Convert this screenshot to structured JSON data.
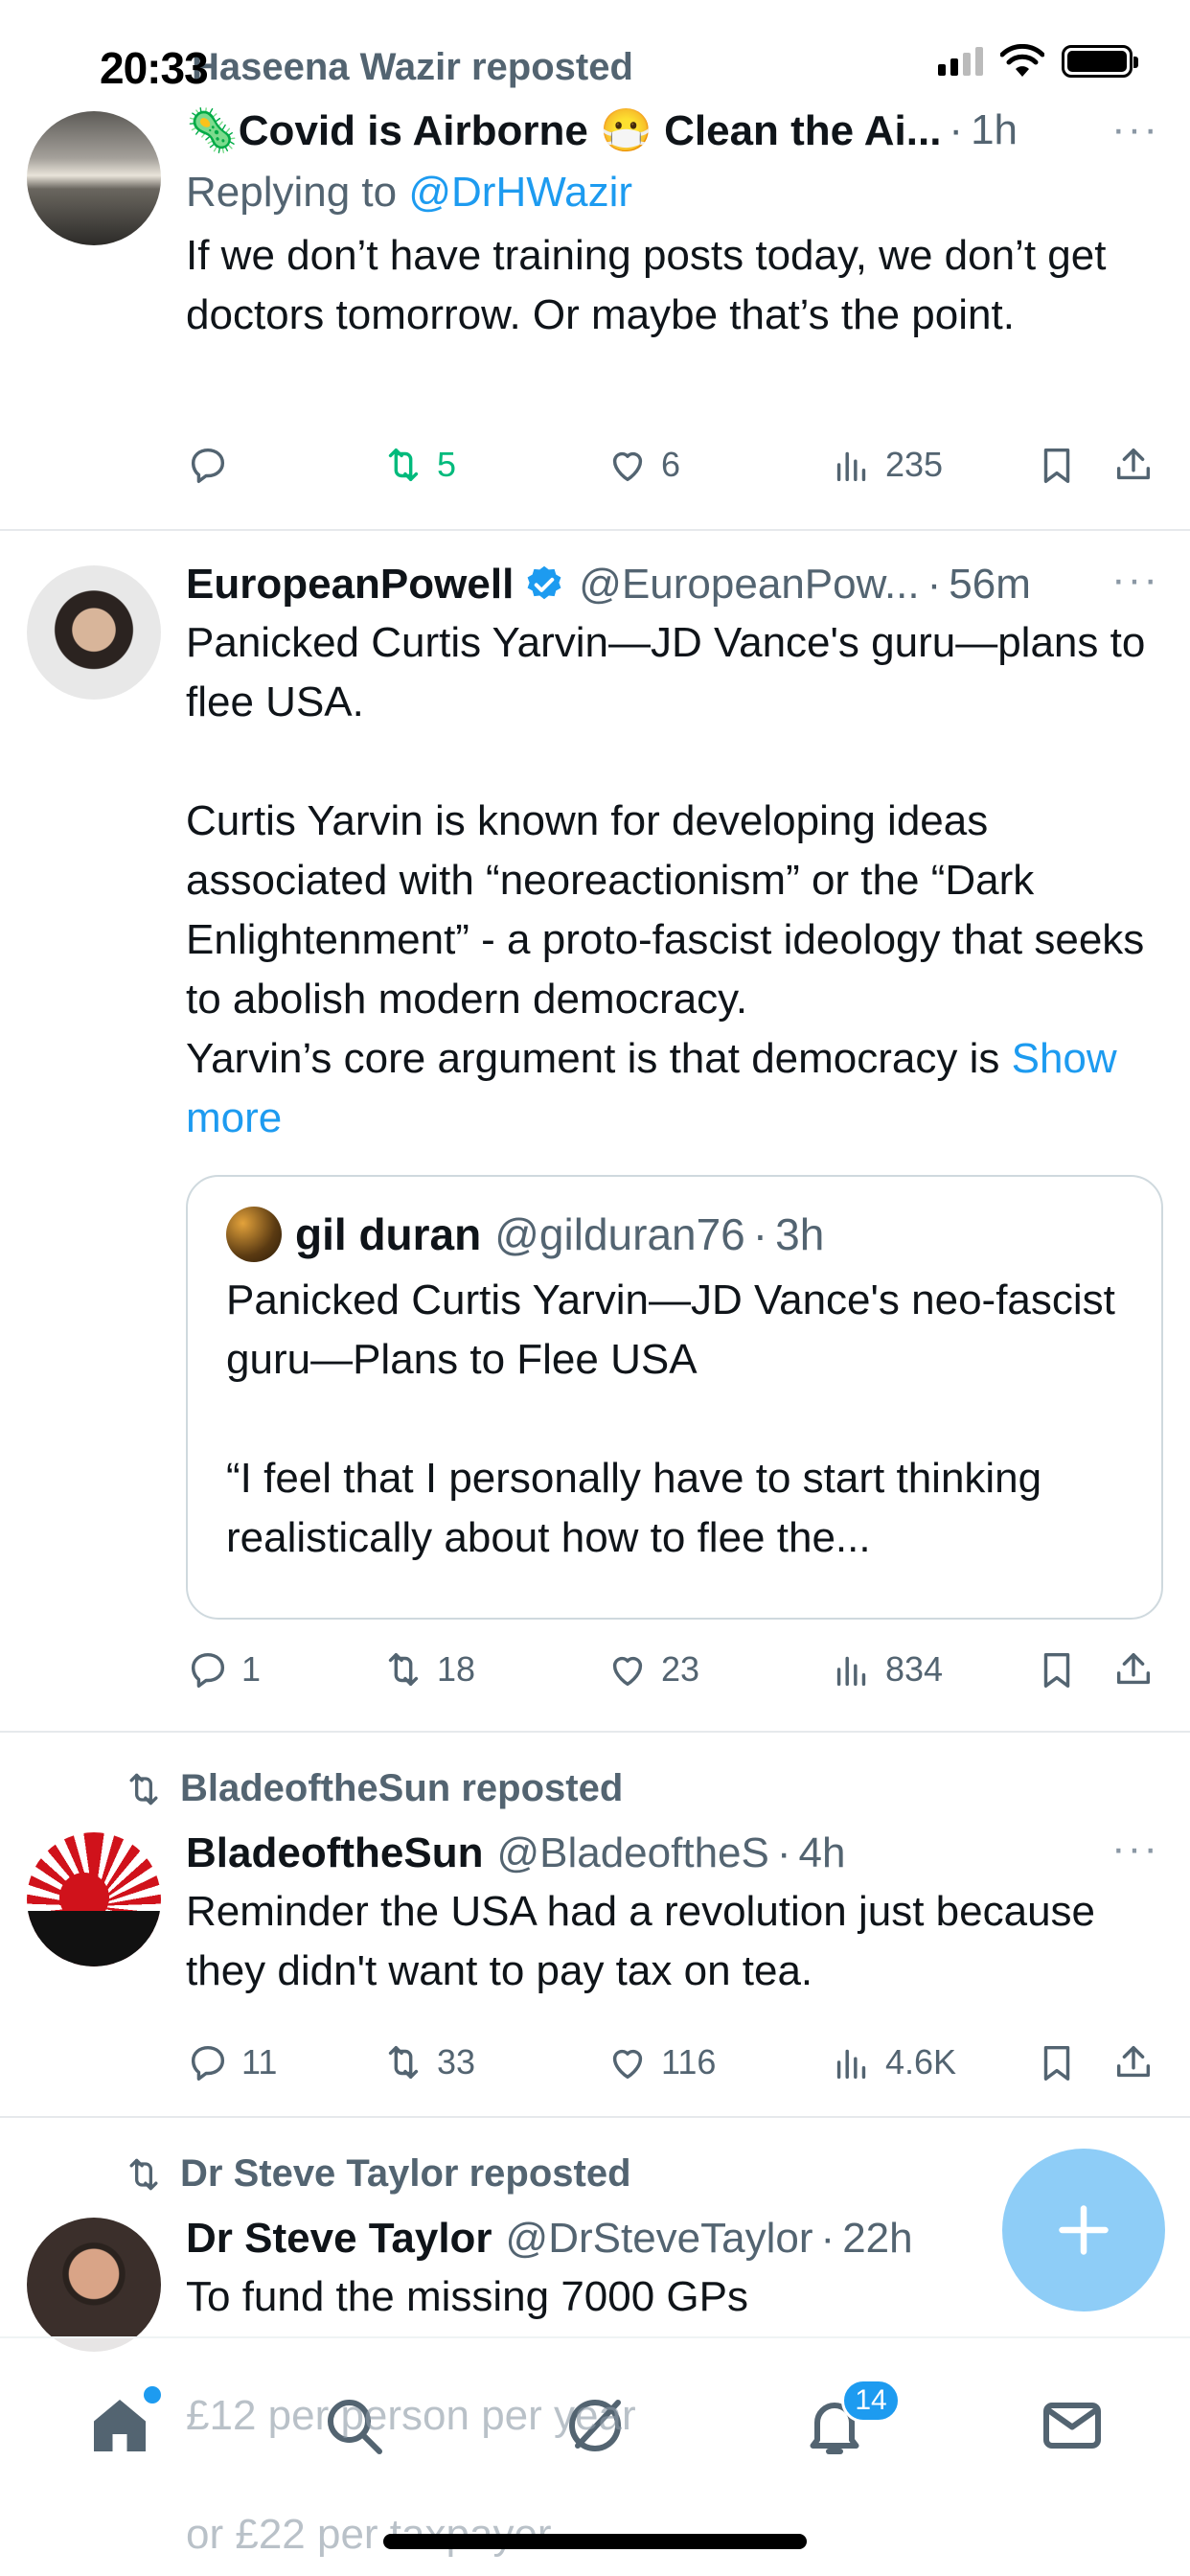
{
  "status_bar": {
    "time": "20:33"
  },
  "tweets": [
    {
      "repost_by": "Haseena Wazir reposted",
      "name": "🦠Covid is Airborne 😷 Clean the Ai...",
      "time": "1h",
      "reply_prefix": "Replying to ",
      "reply_handle": "@DrHWazir",
      "text": "If we don’t have training posts today, we don’t get doctors tomorrow. Or maybe that’s the point.",
      "replies": "",
      "retweets": "5",
      "likes": "6",
      "views": "235"
    },
    {
      "name": "EuropeanPowell",
      "handle": "@EuropeanPow...",
      "time": "56m",
      "text": "Panicked Curtis Yarvin—JD Vance's guru—plans to flee USA.\n\nCurtis Yarvin is known for developing ideas associated with “neoreactionism” or the “Dark Enlightenment” - a proto-fascist ideology that seeks to abolish modern democracy.\nYarvin’s core argument is that democracy is ",
      "show_more": "Show more",
      "quote": {
        "name": "gil duran",
        "handle": "@gilduran76",
        "time": "3h",
        "text": "Panicked Curtis Yarvin—JD Vance's neo-fascist guru—Plans to Flee USA\n\n“I feel that I personally have to start thinking realistically about how to flee the..."
      },
      "replies": "1",
      "retweets": "18",
      "likes": "23",
      "views": "834"
    },
    {
      "repost_by": "BladeoftheSun reposted",
      "name": "BladeoftheSun",
      "handle": "@BladeoftheS",
      "time": "4h",
      "text": "Reminder the USA had a revolution just because they didn't want to pay tax on tea.",
      "replies": "11",
      "retweets": "33",
      "likes": "116",
      "views": "4.6K"
    },
    {
      "repost_by": "Dr Steve Taylor reposted",
      "name": "Dr Steve Taylor",
      "handle": "@DrSteveTaylor",
      "time": "22h",
      "text": "To fund the missing 7000 GPs",
      "text_behind_1": "£12 per person per year",
      "text_behind_2": "or £22 per taxpayer"
    }
  ],
  "tabbar": {
    "notifications_badge": "14"
  },
  "colors": {
    "accent": "#1d9bf0",
    "retweet_green": "#00ba7c",
    "secondary": "#536471"
  }
}
